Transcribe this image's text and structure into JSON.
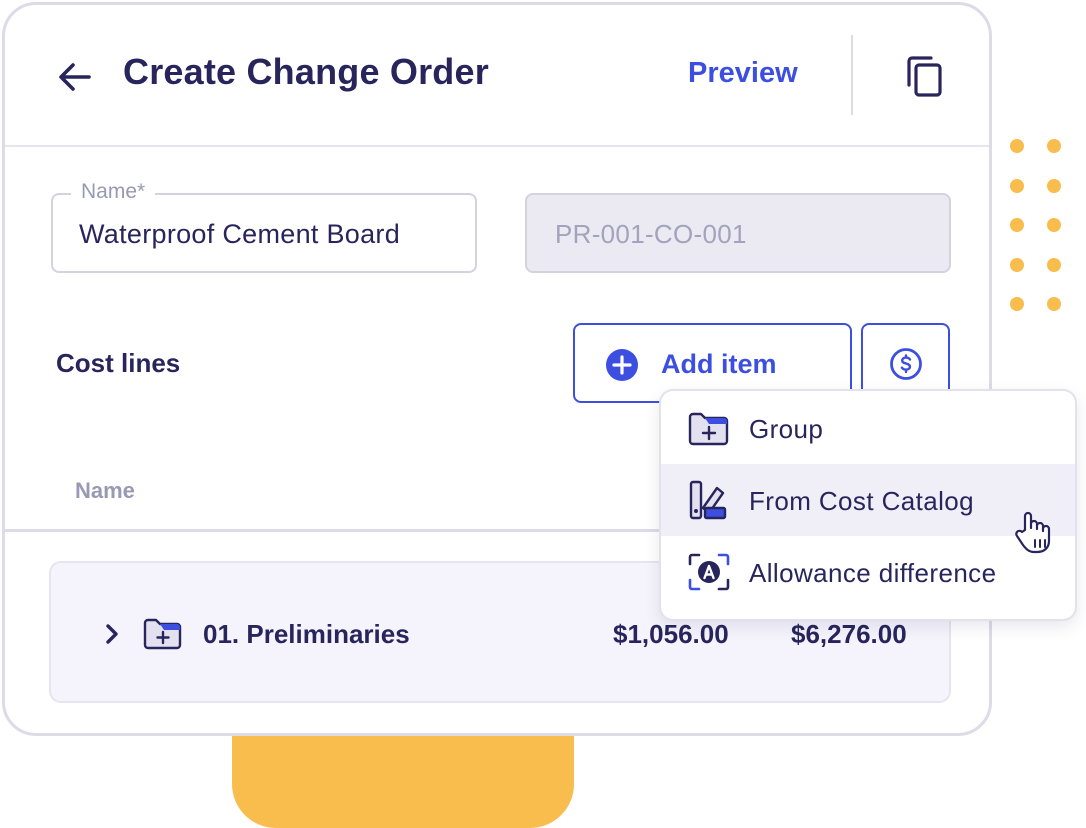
{
  "header": {
    "title": "Create Change Order",
    "preview_label": "Preview"
  },
  "form": {
    "name_label": "Name*",
    "name_value": "Waterproof Cement Board",
    "code_value": "PR-001-CO-001"
  },
  "cost_lines": {
    "label": "Cost lines",
    "add_item_label": "Add item",
    "column_name": "Name"
  },
  "groups": [
    {
      "name": "01. Preliminaries",
      "amount_1": "$1,056.00",
      "amount_2": "$6,276.00"
    }
  ],
  "menu": {
    "items": [
      {
        "label": "Group",
        "icon": "folder-plus-icon"
      },
      {
        "label": "From Cost Catalog",
        "icon": "cost-catalog-icon"
      },
      {
        "label": "Allowance difference",
        "icon": "allowance-icon"
      }
    ],
    "hovered_index": 1
  },
  "colors": {
    "accent": "#3d4fe0",
    "text": "#27255c",
    "muted": "#9a98b3",
    "decor_yellow": "#f8bd4c"
  }
}
